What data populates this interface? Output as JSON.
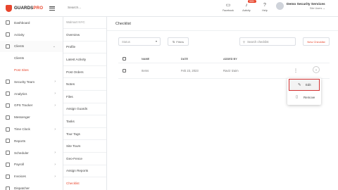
{
  "brand": {
    "name_main": "GUARDS",
    "name_accent": "PRO"
  },
  "search": {
    "placeholder": "Search..."
  },
  "top_icons": [
    {
      "icon": "facebook-icon",
      "glyph": "▭",
      "label": "Facebook"
    },
    {
      "icon": "bell-icon",
      "glyph": "♪",
      "label": "Activity",
      "badge": "999+"
    },
    {
      "icon": "help-icon",
      "glyph": "?",
      "label": "Help"
    }
  ],
  "user": {
    "name": "Demo Security Services",
    "sub": "Site Users"
  },
  "sidebar": {
    "items": [
      {
        "label": "Dashboard",
        "icon": "dashboard-icon"
      },
      {
        "label": "Activity",
        "icon": "activity-icon"
      },
      {
        "label": "Clients",
        "icon": "clients-icon",
        "chevron": "⌄"
      },
      {
        "label": "Clients",
        "sub": true
      },
      {
        "label": "Post Sites",
        "sub": true,
        "active": true
      },
      {
        "label": "Security Team",
        "icon": "security-team-icon",
        "chevron": "›"
      },
      {
        "label": "Analytics",
        "icon": "analytics-icon",
        "chevron": "›"
      },
      {
        "label": "GPS Tracker",
        "icon": "gps-icon",
        "chevron": "›"
      },
      {
        "label": "Messenger",
        "icon": "messenger-icon"
      },
      {
        "label": "Time Clock",
        "icon": "time-clock-icon",
        "chevron": "›"
      },
      {
        "label": "Reports",
        "icon": "reports-icon"
      },
      {
        "label": "Scheduler",
        "icon": "scheduler-icon",
        "chevron": "›"
      },
      {
        "label": "Payroll",
        "icon": "payroll-icon",
        "chevron": "›"
      },
      {
        "label": "Invoices",
        "icon": "invoices-icon",
        "chevron": "›"
      },
      {
        "label": "Dispatcher",
        "icon": "dispatcher-icon"
      }
    ]
  },
  "subnav": {
    "header": "Walmart NYC",
    "items": [
      "Overview",
      "Profile",
      "Latest Activity",
      "Post Orders",
      "Notes",
      "Files",
      "Assign Guards",
      "Tasks",
      "Tour Tags",
      "Site Tours",
      "Geo-Fence",
      "Assign Reports",
      "Checklist"
    ],
    "active_index": 12
  },
  "main": {
    "title": "Checklist",
    "status_placeholder": "Status",
    "filters_label": "Filters",
    "search_placeholder": "Search checklist",
    "new_button": "New Checklist",
    "columns": [
      "NAME",
      "DATE",
      "ADDED BY"
    ],
    "rows": [
      {
        "name": "Items",
        "date": "Feb 23, 2023",
        "added_by": "Raviz Izaim"
      }
    ]
  },
  "menu": {
    "items": [
      {
        "label": "Edit",
        "icon": "pencil-icon",
        "glyph": "✎"
      },
      {
        "label": "Remove",
        "icon": "trash-icon",
        "glyph": "▯"
      }
    ]
  },
  "colors": {
    "accent": "#e8452c",
    "highlight": "#d32f2f"
  }
}
